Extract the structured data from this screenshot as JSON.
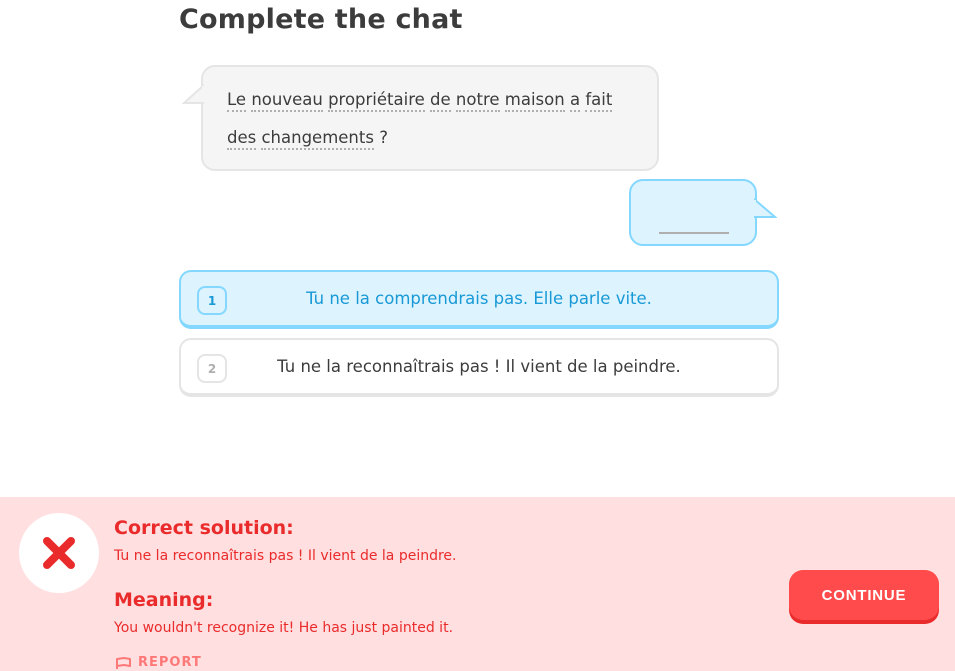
{
  "page": {
    "title": "Complete the chat"
  },
  "chat": {
    "prompt_line1": [
      "Le",
      "nouveau",
      "propriétaire",
      "de",
      "notre",
      "maison",
      "a",
      "fait"
    ],
    "prompt_line2": [
      "des",
      "changements"
    ],
    "prompt_end": "?",
    "answer_blank": ""
  },
  "options": [
    {
      "number": "1",
      "text": "Tu ne la comprendrais pas. Elle parle vite.",
      "selected": true
    },
    {
      "number": "2",
      "text": "Tu ne la reconnaîtrais pas ! Il vient de la peindre.",
      "selected": false
    }
  ],
  "feedback": {
    "status": "incorrect",
    "status_icon": "x-mark-icon",
    "solution_heading": "Correct solution:",
    "solution_text": "Tu ne la reconnaîtrais pas ! Il vient de la peindre.",
    "meaning_heading": "Meaning:",
    "meaning_text": "You wouldn't recognize it! He has just painted it.",
    "report_label": "REPORT",
    "continue_label": "CONTINUE"
  },
  "colors": {
    "error_red": "#ea2b2b",
    "error_bg": "#ffdfe0",
    "selected_blue": "#1899d6",
    "selected_bg": "#ddf4ff",
    "button_red": "#ff4b4b"
  }
}
